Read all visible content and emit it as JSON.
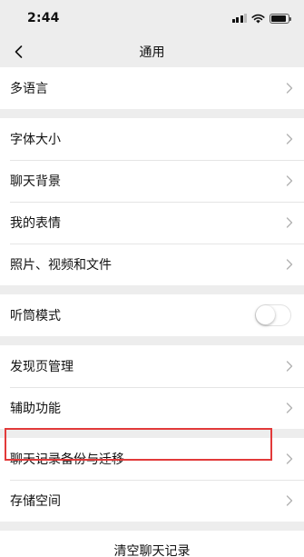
{
  "status_bar": {
    "time": "2:44",
    "signal_icon": "cellular-signal-icon",
    "wifi_icon": "wifi-icon",
    "battery_icon": "battery-icon",
    "battery_level": 0.9
  },
  "nav": {
    "back_icon": "chevron-left-icon",
    "title": "通用"
  },
  "groups": [
    {
      "items": [
        {
          "label": "多语言",
          "control": "chevron"
        }
      ]
    },
    {
      "items": [
        {
          "label": "字体大小",
          "control": "chevron"
        },
        {
          "label": "聊天背景",
          "control": "chevron"
        },
        {
          "label": "我的表情",
          "control": "chevron"
        },
        {
          "label": "照片、视频和文件",
          "control": "chevron"
        }
      ]
    },
    {
      "items": [
        {
          "label": "听筒模式",
          "control": "toggle",
          "toggle_on": false
        }
      ]
    },
    {
      "items": [
        {
          "label": "发现页管理",
          "control": "chevron"
        },
        {
          "label": "辅助功能",
          "control": "chevron"
        }
      ]
    },
    {
      "items": [
        {
          "label": "聊天记录备份与迁移",
          "control": "chevron",
          "highlighted": true
        },
        {
          "label": "存储空间",
          "control": "chevron"
        }
      ]
    }
  ],
  "clear_chat": {
    "label": "清空聊天记录"
  },
  "colors": {
    "background": "#ededed",
    "cell": "#ffffff",
    "highlight": "#e23a3a"
  }
}
